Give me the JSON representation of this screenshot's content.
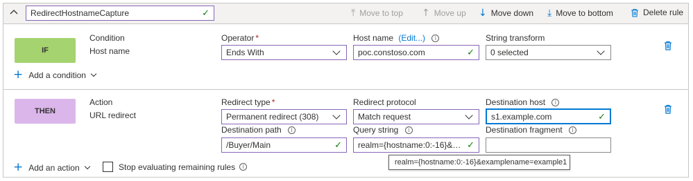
{
  "rule": {
    "name": "RedirectHostnameCapture",
    "toolbar": {
      "move_to_top": "Move to top",
      "move_up": "Move up",
      "move_down": "Move down",
      "move_to_bottom": "Move to bottom",
      "delete_rule": "Delete rule"
    }
  },
  "condition": {
    "tag": "IF",
    "title": "Condition",
    "subtitle": "Host name",
    "operator_label": "Operator",
    "operator_value": "Ends With",
    "host_label": "Host name",
    "host_edit": "(Edit...)",
    "host_value": "poc.constoso.com",
    "transform_label": "String transform",
    "transform_value": "0 selected",
    "add_condition": "Add a condition"
  },
  "action": {
    "tag": "THEN",
    "title": "Action",
    "subtitle": "URL redirect",
    "redirect_type_label": "Redirect type",
    "redirect_type_value": "Permanent redirect (308)",
    "protocol_label": "Redirect protocol",
    "protocol_value": "Match request",
    "dest_host_label": "Destination host",
    "dest_host_value": "s1.example.com",
    "dest_path_label": "Destination path",
    "dest_path_value": "/Buyer/Main",
    "query_label": "Query string",
    "query_value": "realm={hostname:0:-16}&ex...",
    "fragment_label": "Destination fragment",
    "fragment_value": "",
    "add_action": "Add an action",
    "stop_eval": "Stop evaluating remaining rules",
    "tooltip": "realm={hostname:0:-16}&examplename=example1"
  },
  "colors": {
    "if_tag": "#a4d36f",
    "then_tag": "#dbb6ea",
    "accent": "#0078d4",
    "focus_border": "#8764b8"
  }
}
